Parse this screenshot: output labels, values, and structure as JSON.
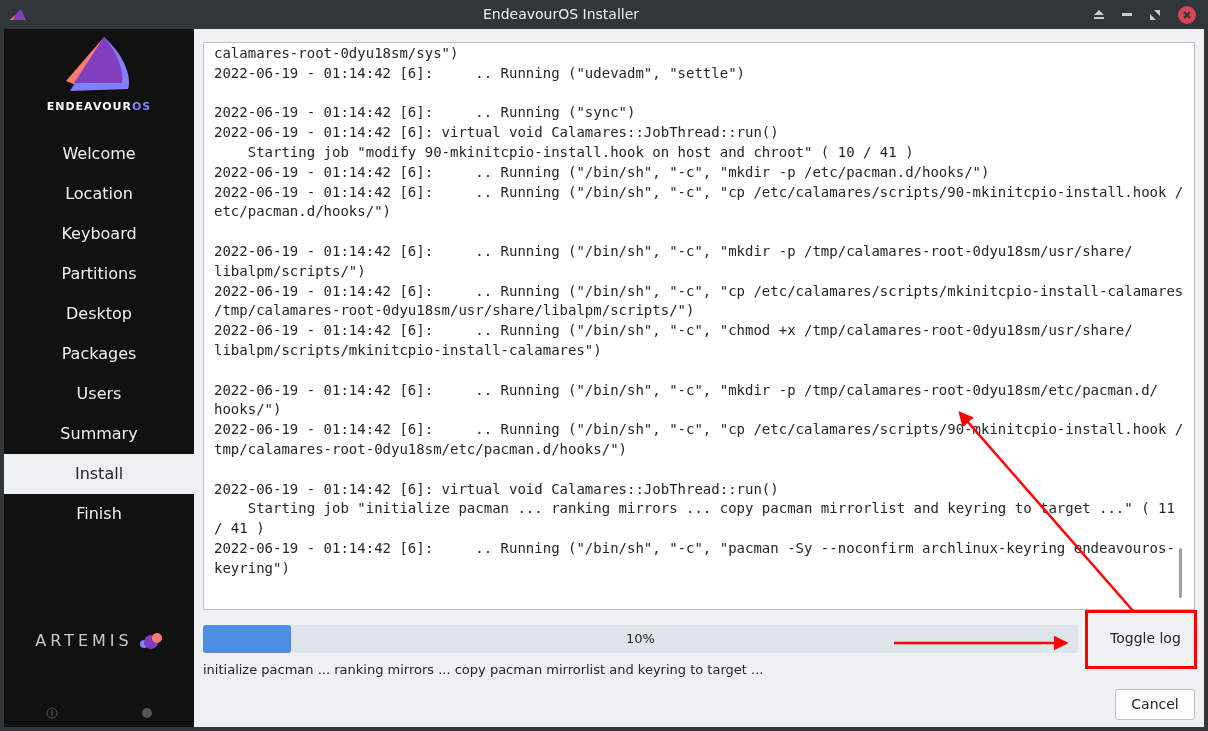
{
  "window": {
    "title": "EndeavourOS Installer"
  },
  "logo": {
    "name_main": "ENDEAVOUR",
    "name_accent": "OS"
  },
  "steps": [
    {
      "label": "Welcome",
      "selected": false
    },
    {
      "label": "Location",
      "selected": false
    },
    {
      "label": "Keyboard",
      "selected": false
    },
    {
      "label": "Partitions",
      "selected": false
    },
    {
      "label": "Desktop",
      "selected": false
    },
    {
      "label": "Packages",
      "selected": false
    },
    {
      "label": "Users",
      "selected": false
    },
    {
      "label": "Summary",
      "selected": false
    },
    {
      "label": "Install",
      "selected": true
    },
    {
      "label": "Finish",
      "selected": false
    }
  ],
  "release": {
    "name": "ARTEMIS"
  },
  "log_blocks": [
    [
      "calamares-root-0dyu18sm/sys\")",
      "2022-06-19 - 01:14:42 [6]:     .. Running (\"udevadm\", \"settle\")"
    ],
    [
      "2022-06-19 - 01:14:42 [6]:     .. Running (\"sync\")",
      "2022-06-19 - 01:14:42 [6]: virtual void Calamares::JobThread::run()",
      "    Starting job \"modify 90-mkinitcpio-install.hook on host and chroot\" ( 10 / 41 )",
      "2022-06-19 - 01:14:42 [6]:     .. Running (\"/bin/sh\", \"-c\", \"mkdir -p /etc/pacman.d/hooks/\")",
      "2022-06-19 - 01:14:42 [6]:     .. Running (\"/bin/sh\", \"-c\", \"cp /etc/calamares/scripts/90-mkinitcpio-install.hook /",
      "etc/pacman.d/hooks/\")"
    ],
    [
      "2022-06-19 - 01:14:42 [6]:     .. Running (\"/bin/sh\", \"-c\", \"mkdir -p /tmp/calamares-root-0dyu18sm/usr/share/",
      "libalpm/scripts/\")",
      "2022-06-19 - 01:14:42 [6]:     .. Running (\"/bin/sh\", \"-c\", \"cp /etc/calamares/scripts/mkinitcpio-install-calamares",
      "/tmp/calamares-root-0dyu18sm/usr/share/libalpm/scripts/\")",
      "2022-06-19 - 01:14:42 [6]:     .. Running (\"/bin/sh\", \"-c\", \"chmod +x /tmp/calamares-root-0dyu18sm/usr/share/",
      "libalpm/scripts/mkinitcpio-install-calamares\")"
    ],
    [
      "2022-06-19 - 01:14:42 [6]:     .. Running (\"/bin/sh\", \"-c\", \"mkdir -p /tmp/calamares-root-0dyu18sm/etc/pacman.d/",
      "hooks/\")",
      "2022-06-19 - 01:14:42 [6]:     .. Running (\"/bin/sh\", \"-c\", \"cp /etc/calamares/scripts/90-mkinitcpio-install.hook /",
      "tmp/calamares-root-0dyu18sm/etc/pacman.d/hooks/\")"
    ],
    [
      "2022-06-19 - 01:14:42 [6]: virtual void Calamares::JobThread::run()",
      "    Starting job \"initialize pacman ... ranking mirrors ... copy pacman mirrorlist and keyring to target ...\" ( 11",
      "/ 41 )",
      "2022-06-19 - 01:14:42 [6]:     .. Running (\"/bin/sh\", \"-c\", \"pacman -Sy --noconfirm archlinux-keyring endeavouros-",
      "keyring\")"
    ]
  ],
  "progress": {
    "level": 0.1,
    "reading": "10%"
  },
  "toggle_button": "Toggle log",
  "status": "initialize pacman ... ranking mirrors ... copy pacman mirrorlist and keyring to target ...",
  "cancel_button": "Cancel"
}
